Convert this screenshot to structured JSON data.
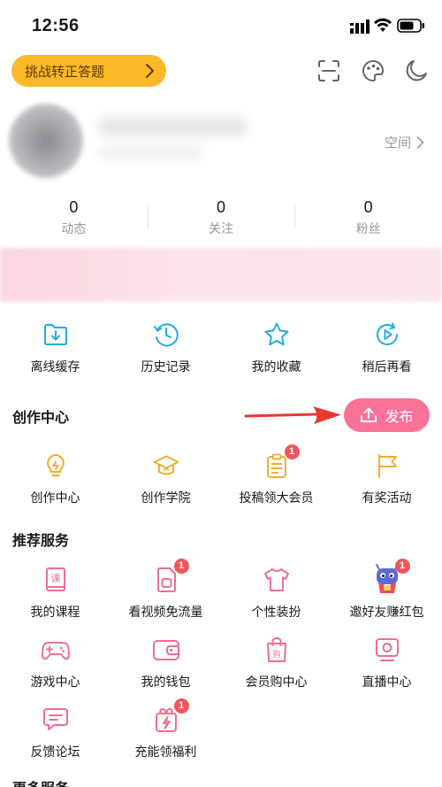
{
  "status_bar": {
    "time": "12:56"
  },
  "top": {
    "challenge_label": "挑战转正答题",
    "icons": [
      "scan-icon",
      "palette-icon",
      "moon-icon"
    ]
  },
  "profile": {
    "space_label": "空间"
  },
  "stats": [
    {
      "value": "0",
      "label": "动态"
    },
    {
      "value": "0",
      "label": "关注"
    },
    {
      "value": "0",
      "label": "粉丝"
    }
  ],
  "quick": [
    {
      "label": "离线缓存",
      "icon": "download-folder-icon"
    },
    {
      "label": "历史记录",
      "icon": "history-clock-icon"
    },
    {
      "label": "我的收藏",
      "icon": "star-icon"
    },
    {
      "label": "稍后再看",
      "icon": "play-later-icon"
    }
  ],
  "creation": {
    "title": "创作中心",
    "publish_label": "发布",
    "items": [
      {
        "label": "创作中心",
        "icon": "lightbulb-icon"
      },
      {
        "label": "创作学院",
        "icon": "graduation-cap-icon"
      },
      {
        "label": "投稿领大会员",
        "icon": "clipboard-icon",
        "badge": "1"
      },
      {
        "label": "有奖活动",
        "icon": "flag-icon"
      }
    ]
  },
  "recommend": {
    "title": "推荐服务",
    "items": [
      {
        "label": "我的课程",
        "icon": "course-book-icon"
      },
      {
        "label": "看视频免流量",
        "icon": "sim-card-icon",
        "badge": "1"
      },
      {
        "label": "个性装扮",
        "icon": "tshirt-icon"
      },
      {
        "label": "邀好友赚红包",
        "icon": "mascot-icon",
        "badge": "1"
      },
      {
        "label": "游戏中心",
        "icon": "gamepad-icon"
      },
      {
        "label": "我的钱包",
        "icon": "wallet-icon"
      },
      {
        "label": "会员购中心",
        "icon": "shopping-bag-icon"
      },
      {
        "label": "直播中心",
        "icon": "live-tv-icon"
      },
      {
        "label": "反馈论坛",
        "icon": "feedback-chat-icon"
      },
      {
        "label": "充能领福利",
        "icon": "energy-gift-icon",
        "badge": "1"
      }
    ]
  },
  "more": {
    "title": "更多服务"
  },
  "colors": {
    "blue": "#23ade5",
    "yellow": "#f0b02a",
    "pink": "#fb7299",
    "badge": "#f2545b",
    "challenge": "#fdb829"
  }
}
